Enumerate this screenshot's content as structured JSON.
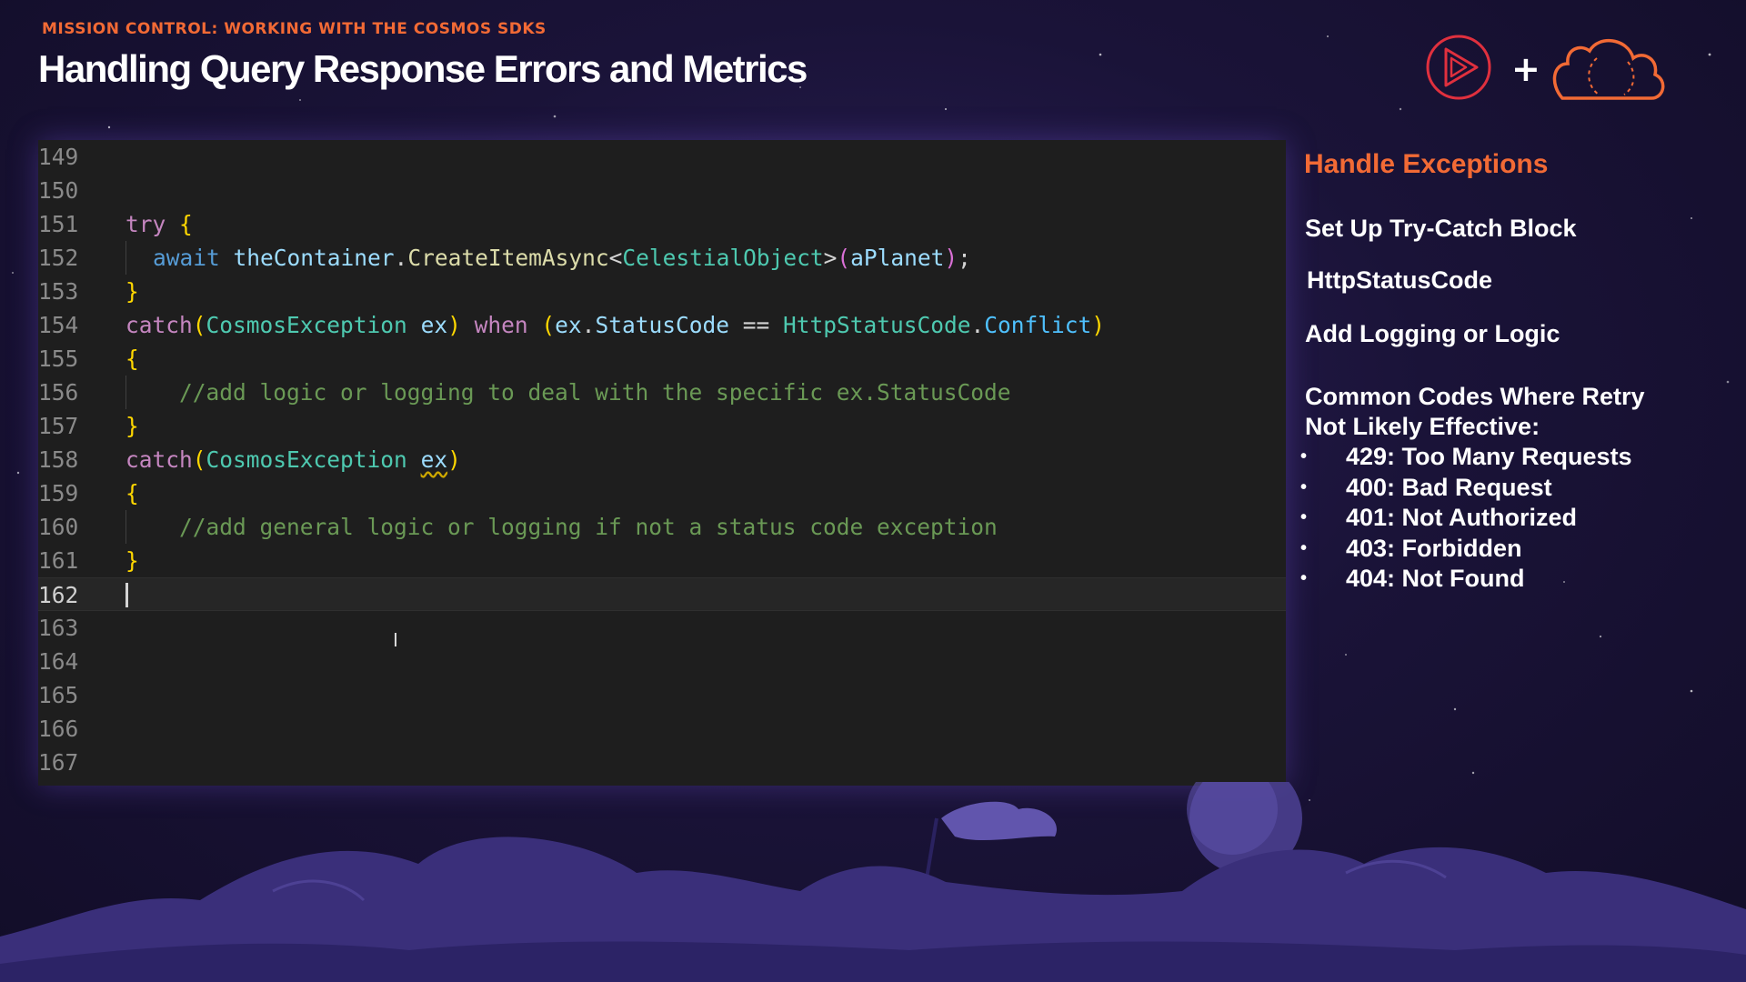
{
  "header": {
    "subtitle": "MISSION CONTROL: WORKING WITH THE COSMOS SDKS",
    "title": "Handling Query Response Errors and Metrics",
    "plus": "+"
  },
  "editor": {
    "line_numbers": [
      "149",
      "150",
      "151",
      "152",
      "153",
      "154",
      "155",
      "156",
      "157",
      "158",
      "159",
      "160",
      "161",
      "162",
      "163",
      "164",
      "165",
      "166",
      "167"
    ],
    "current_line": "162",
    "code": {
      "l151_try": "try",
      "l152_await": "await",
      "l152_container": "theContainer",
      "l152_method": "CreateItemAsync",
      "l152_type": "CelestialObject",
      "l152_arg": "aPlanet",
      "l154_catch": "catch",
      "l154_type": "CosmosException",
      "l154_var": "ex",
      "l154_when": "when",
      "l154_var2": "ex",
      "l154_prop": "StatusCode",
      "l154_op": "==",
      "l154_enum": "HttpStatusCode",
      "l154_member": "Conflict",
      "l156_comment": "//add logic or logging to deal with the specific ex.StatusCode",
      "l158_catch": "catch",
      "l158_type": "CosmosException",
      "l158_var": "ex",
      "l160_comment": "//add general logic or logging if not a status code exception"
    }
  },
  "panel": {
    "heading": "Handle Exceptions",
    "items": [
      "Set Up Try-Catch Block",
      "HttpStatusCode",
      "Add Logging or Logic"
    ],
    "codes_heading_line1": "Common Codes Where Retry",
    "codes_heading_line2": "Not Likely Effective:",
    "bullet": "•",
    "codes": [
      "429: Too Many Requests",
      "400: Bad Request",
      "401: Not Authorized",
      "403: Forbidden",
      "404: Not Found"
    ]
  },
  "colors": {
    "accent": "#f26a35",
    "background": "#1a1338",
    "editor_bg": "#1e1e1e"
  },
  "icons": [
    "play-logo-icon",
    "cloud-logo-icon",
    "text-cursor-icon"
  ]
}
